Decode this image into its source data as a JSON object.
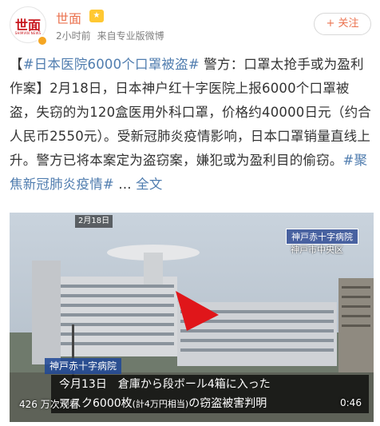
{
  "header": {
    "avatar_text": "世面",
    "avatar_subtext": "SHIMIAN NEWS",
    "account_name": "世面",
    "vip_icon": "vip-badge-icon",
    "time": "2小时前",
    "source": "来自专业版微博",
    "follow_label": "+ 关注"
  },
  "post": {
    "bracket_open": "【",
    "tag1": "#日本医院6000个口罩被盗#",
    "headline_rest": " 警方：口罩太抢手或为盈利作案】",
    "paragraph": "2月18日，日本神户红十字医院上报6000个口罩被盗，失窃的为120盒医用外科口罩，价格约40000日元（约合人民币2550元）。受新冠肺炎疫情影响，日本口罩销量直线上升。警方已将本案定为盗窃案，嫌犯或为盈利目的偷窃。",
    "tag2": "#聚焦新冠肺炎疫情#",
    "ellipsis": " ... ",
    "more_label": "全文"
  },
  "video": {
    "date_stamp": "2月18日",
    "channel_logo": "神戸赤十字病院",
    "location": "神戸市中央区",
    "hospital_label": "神戸赤十字病院",
    "subtitle_line1": "今月13日　倉庫から段ボール4箱に入った",
    "subtitle_line2_a": "マスク6000枚",
    "subtitle_line2_small": "(計4万円相当)",
    "subtitle_line2_b": "の窃盗被害判明",
    "view_count": "426 万次观看",
    "duration": "0:46"
  },
  "colors": {
    "accent_orange": "#eb7350",
    "link_blue": "#507daf",
    "brand_red": "#c8161d",
    "arrow_red": "#e0161a"
  }
}
